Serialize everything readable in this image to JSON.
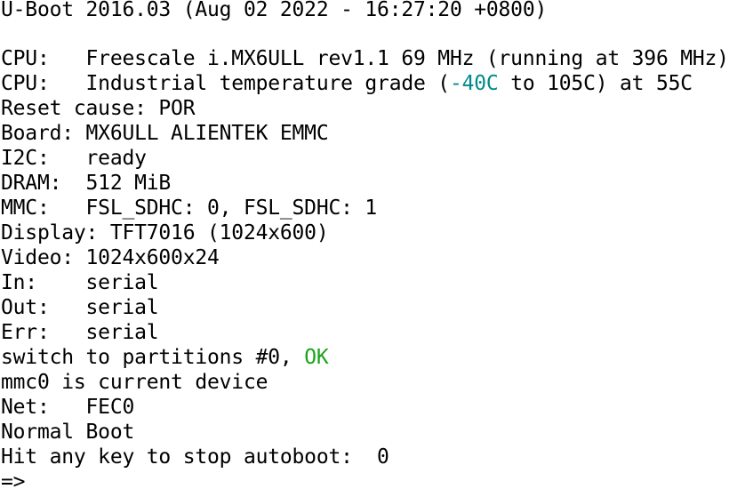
{
  "terminal": {
    "banner": "U-Boot 2016.03 (Aug 02 2022 - 16:27:20 +0800)",
    "cpu1": "CPU:   Freescale i.MX6ULL rev1.1 69 MHz (running at 396 MHz)",
    "cpu2_prefix": "CPU:   Industrial temperature grade (",
    "cpu2_temp_low": "-40C",
    "cpu2_suffix": " to 105C) at 55C",
    "reset": "Reset cause: POR",
    "board": "Board: MX6ULL ALIENTEK EMMC",
    "i2c": "I2C:   ready",
    "dram": "DRAM:  512 MiB",
    "mmc": "MMC:   FSL_SDHC: 0, FSL_SDHC: 1",
    "display": "Display: TFT7016 (1024x600)",
    "video": "Video: 1024x600x24",
    "in": "In:    serial",
    "out": "Out:   serial",
    "err": "Err:   serial",
    "switch_prefix": "switch to partitions #0, ",
    "switch_ok": "OK",
    "mmc_dev": "mmc0 is current device",
    "net": "Net:   FEC0",
    "boot_mode": "Normal Boot",
    "autoboot": "Hit any key to stop autoboot:  0",
    "prompt": "=>"
  },
  "colors": {
    "background": "#ffffff",
    "text": "#000000",
    "temperature": "#008b8b",
    "ok": "#1aa51a"
  }
}
